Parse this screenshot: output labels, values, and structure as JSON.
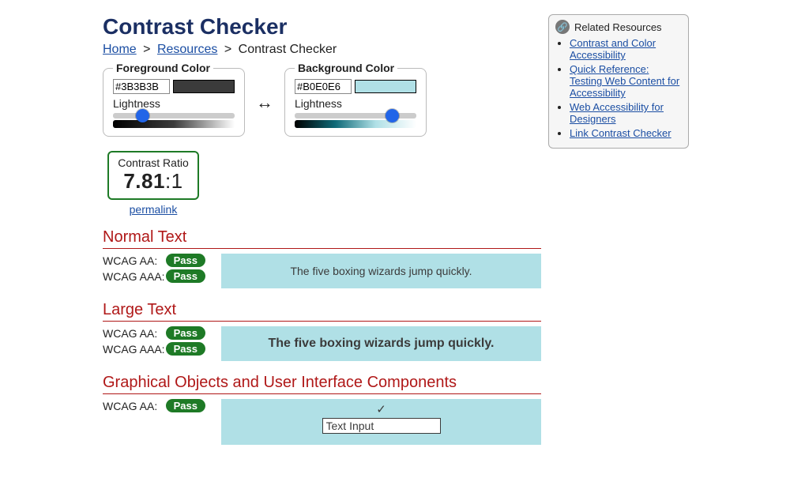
{
  "title": "Contrast Checker",
  "breadcrumb": {
    "home": "Home",
    "resources": "Resources",
    "current": "Contrast Checker",
    "sep": ">"
  },
  "fg": {
    "legend": "Foreground Color",
    "hex": "#3B3B3B",
    "lightness_label": "Lightness",
    "swatch_color": "#3b3b3b",
    "slider_pct": 24,
    "grad_css": "linear-gradient(to right, #000000, #3b3b3b, #ffffff)"
  },
  "bg": {
    "legend": "Background Color",
    "hex": "#B0E0E6",
    "lightness_label": "Lightness",
    "swatch_color": "#b0e0e6",
    "slider_pct": 80,
    "grad_css": "linear-gradient(to right, #000000, #0f6a78, #b0e0e6, #ffffff)"
  },
  "swap_glyph": "↔",
  "ratio": {
    "label": "Contrast Ratio",
    "value": "7.81",
    "suffix": ":1",
    "permalink": "permalink"
  },
  "sample_text": "The five boxing wizards jump quickly.",
  "sections": {
    "normal": {
      "title": "Normal Text",
      "aa_label": "WCAG AA:",
      "aaa_label": "WCAG AAA:",
      "aa": "Pass",
      "aaa": "Pass"
    },
    "large": {
      "title": "Large Text",
      "aa_label": "WCAG AA:",
      "aaa_label": "WCAG AAA:",
      "aa": "Pass",
      "aaa": "Pass"
    },
    "ui": {
      "title": "Graphical Objects and User Interface Components",
      "aa_label": "WCAG AA:",
      "aa": "Pass",
      "check": "✓",
      "input_value": "Text Input"
    }
  },
  "sidebar": {
    "title": "Related Resources",
    "items": [
      "Contrast and Color Accessibility",
      "Quick Reference: Testing Web Content for Accessibility",
      "Web Accessibility for Designers",
      "Link Contrast Checker"
    ]
  }
}
